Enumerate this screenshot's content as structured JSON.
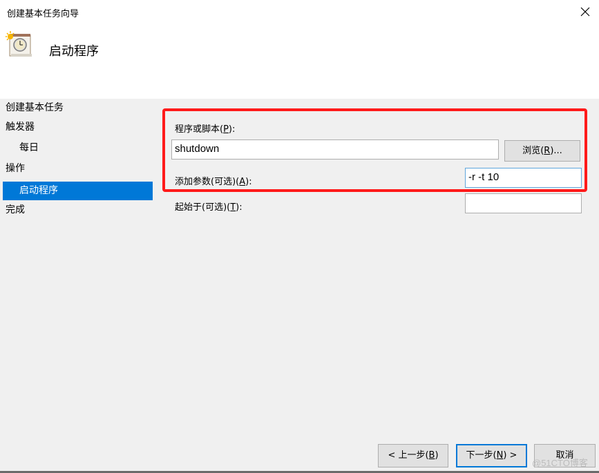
{
  "window": {
    "title": "创建基本任务向导",
    "close_icon": "close-icon",
    "heading": "启动程序",
    "heading_icon": "scheduled-task-clock-icon"
  },
  "sidebar": {
    "items": [
      {
        "label": "创建基本任务",
        "indent": false,
        "active": false
      },
      {
        "label": "触发器",
        "indent": false,
        "active": false
      },
      {
        "label": "每日",
        "indent": true,
        "active": false
      },
      {
        "label": "操作",
        "indent": false,
        "active": false
      },
      {
        "label": "启动程序",
        "indent": true,
        "active": true
      },
      {
        "label": "完成",
        "indent": false,
        "active": false
      }
    ]
  },
  "form": {
    "program_label": "程序或脚本(",
    "program_accel": "P",
    "program_label_end": "):",
    "program_value": "shutdown",
    "browse_label": "浏览(",
    "browse_accel": "R",
    "browse_label_end": ")...",
    "args_label": "添加参数(可选)(",
    "args_accel": "A",
    "args_label_end": "):",
    "args_value": "-r -t 10",
    "startin_label": "起始于(可选)(",
    "startin_accel": "T",
    "startin_label_end": "):",
    "startin_value": ""
  },
  "footer": {
    "back_label": "< 上一步(",
    "back_accel": "B",
    "back_end": ")",
    "next_label": "下一步(",
    "next_accel": "N",
    "next_end": ") >",
    "cancel_label": "取消",
    "watermark": "@51CTO博客"
  },
  "colors": {
    "accent": "#0078d7",
    "highlight_box": "#ff1a1a"
  }
}
